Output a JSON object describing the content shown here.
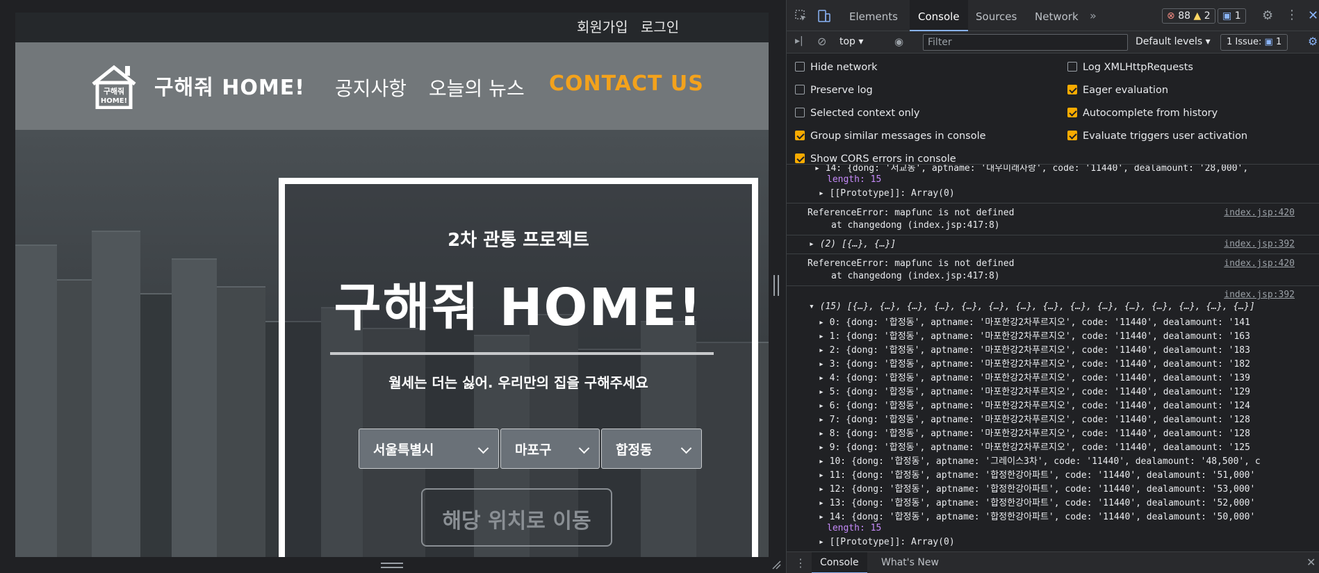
{
  "site": {
    "auth": {
      "signup": "회원가입",
      "login": "로그인"
    },
    "brand": "구해줘 HOME!",
    "logo_text": "구해줘\nHOME!",
    "nav": {
      "notice": "공지사항",
      "news": "오늘의 뉴스",
      "contact": "CONTACT US"
    },
    "hero": {
      "subtitle": "2차 관통 프로젝트",
      "title": "구해줘 HOME!",
      "tagline": "월세는 더는 싫어. 우리만의 집을 구해주세요",
      "select_city": "서울특별시",
      "select_gu": "마포구",
      "select_dong": "합정동",
      "go_button": "해당 위치로 이동"
    }
  },
  "devtools": {
    "tabs": [
      "Elements",
      "Console",
      "Sources",
      "Network"
    ],
    "active_tab": "Console",
    "errors": "88",
    "warnings": "2",
    "messages": "1",
    "context": "top",
    "filter_placeholder": "Filter",
    "levels": "Default levels",
    "issues": "1 Issue:",
    "issues_count": "1",
    "settings": [
      {
        "label": "Hide network",
        "checked": false
      },
      {
        "label": "Log XMLHttpRequests",
        "checked": false
      },
      {
        "label": "Preserve log",
        "checked": false
      },
      {
        "label": "Eager evaluation",
        "checked": true
      },
      {
        "label": "Selected context only",
        "checked": false
      },
      {
        "label": "Autocomplete from history",
        "checked": true
      },
      {
        "label": "Group similar messages in console",
        "checked": true
      },
      {
        "label": "Evaluate triggers user activation",
        "checked": true
      },
      {
        "label": "Show CORS errors in console",
        "checked": true
      }
    ],
    "console": {
      "top_partial": "▸ 14: {dong: '서교동', aptname: '대우미래사랑', code: '11440', dealamount: '28,000',",
      "length_label": "length: 15",
      "proto_label": "▸ [[Prototype]]: Array(0)",
      "error1": "ReferenceError: mapfunc is not defined",
      "error1_at": "at changedong (index.jsp:417:8)",
      "error1_src": "index.jsp:420",
      "array2": "▸ (2) [{…}, {…}]",
      "array2_src": "index.jsp:392",
      "error2": "ReferenceError: mapfunc is not defined",
      "error2_at": "at changedong (index.jsp:417:8)",
      "error2_src": "index.jsp:420",
      "array15_src": "index.jsp:392",
      "array15": "▾ (15) [{…}, {…}, {…}, {…}, {…}, {…}, {…}, {…}, {…}, {…}, {…}, {…}, {…}, {…}, {…}]",
      "rows": [
        "▸ 0: {dong: '합정동', aptname: '마포한강2차푸르지오', code: '11440', dealamount: '141",
        "▸ 1: {dong: '합정동', aptname: '마포한강2차푸르지오', code: '11440', dealamount: '163",
        "▸ 2: {dong: '합정동', aptname: '마포한강2차푸르지오', code: '11440', dealamount: '183",
        "▸ 3: {dong: '합정동', aptname: '마포한강2차푸르지오', code: '11440', dealamount: '182",
        "▸ 4: {dong: '합정동', aptname: '마포한강2차푸르지오', code: '11440', dealamount: '139",
        "▸ 5: {dong: '합정동', aptname: '마포한강2차푸르지오', code: '11440', dealamount: '129",
        "▸ 6: {dong: '합정동', aptname: '마포한강2차푸르지오', code: '11440', dealamount: '124",
        "▸ 7: {dong: '합정동', aptname: '마포한강2차푸르지오', code: '11440', dealamount: '128",
        "▸ 8: {dong: '합정동', aptname: '마포한강2차푸르지오', code: '11440', dealamount: '128",
        "▸ 9: {dong: '합정동', aptname: '마포한강2차푸르지오', code: '11440', dealamount: '125",
        "▸ 10: {dong: '합정동', aptname: '그레이스3차', code: '11440', dealamount: '48,500', c",
        "▸ 11: {dong: '합정동', aptname: '합정한강아파트', code: '11440', dealamount: '51,000'",
        "▸ 12: {dong: '합정동', aptname: '합정한강아파트', code: '11440', dealamount: '53,000'",
        "▸ 13: {dong: '합정동', aptname: '합정한강아파트', code: '11440', dealamount: '52,000'",
        "▸ 14: {dong: '합정동', aptname: '합정한강아파트', code: '11440', dealamount: '50,000'"
      ],
      "length_bottom": "length: 15",
      "proto_bottom": "▸ [[Prototype]]: Array(0)"
    },
    "bottom_tabs": [
      "Console",
      "What's New"
    ]
  }
}
